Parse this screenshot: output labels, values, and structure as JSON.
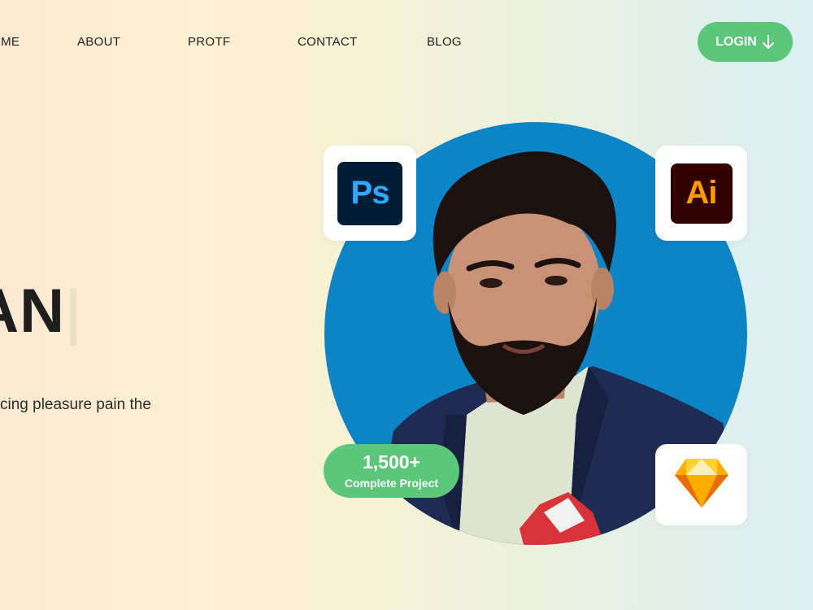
{
  "nav": {
    "items": [
      {
        "label": "HOME"
      },
      {
        "label": "ABOUT"
      },
      {
        "label": "PROTF"
      },
      {
        "label": "CONTACT"
      },
      {
        "label": "BLOG"
      }
    ],
    "login_label": "LOGIN",
    "login_icon": "arrow-down-icon"
  },
  "hero": {
    "heading_visible": "AN.",
    "subtitle_visible": "cing pleasure pain the"
  },
  "tools": {
    "photoshop": {
      "label": "Ps",
      "icon": "photoshop-icon"
    },
    "illustrator": {
      "label": "Ai",
      "icon": "illustrator-icon"
    },
    "sketch": {
      "icon": "sketch-diamond-icon"
    }
  },
  "stats": {
    "number": "1,500+",
    "label": "Complete Project"
  },
  "colors": {
    "accent_green": "#5cc67a",
    "portrait_blue": "#0c84c6",
    "ps_bg": "#001e36",
    "ps_fg": "#31a8ff",
    "ai_bg": "#330000",
    "ai_fg": "#ff9a00"
  }
}
